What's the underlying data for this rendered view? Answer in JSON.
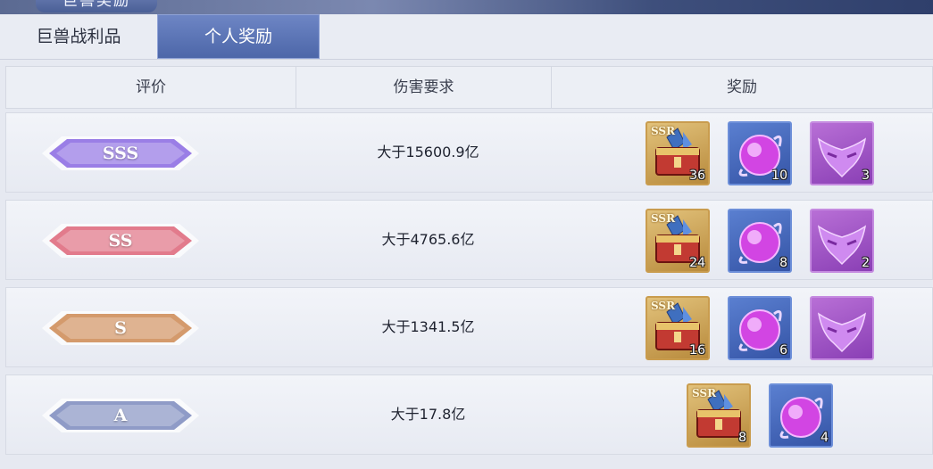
{
  "window": {
    "title": "巨兽奖励"
  },
  "tabs": [
    {
      "label": "巨兽战利品",
      "active": false
    },
    {
      "label": "个人奖励",
      "active": true
    }
  ],
  "table": {
    "headers": [
      "评价",
      "伤害要求",
      "奖励"
    ],
    "rows": [
      {
        "grade": "SSS",
        "grade_color": "#9a7ee6",
        "requirement": "大于15600.9亿",
        "rewards": [
          {
            "icon": "ssr-chest-icon",
            "tag": "SSR",
            "count": "36"
          },
          {
            "icon": "purple-orb-icon",
            "count": "10"
          },
          {
            "icon": "purple-mask-icon",
            "count": "3"
          }
        ]
      },
      {
        "grade": "SS",
        "grade_color": "#e27b8c",
        "requirement": "大于4765.6亿",
        "rewards": [
          {
            "icon": "ssr-chest-icon",
            "tag": "SSR",
            "count": "24"
          },
          {
            "icon": "purple-orb-icon",
            "count": "8"
          },
          {
            "icon": "purple-mask-icon",
            "count": "2"
          }
        ]
      },
      {
        "grade": "S",
        "grade_color": "#d49a6c",
        "requirement": "大于1341.5亿",
        "rewards": [
          {
            "icon": "ssr-chest-icon",
            "tag": "SSR",
            "count": "16"
          },
          {
            "icon": "purple-orb-icon",
            "count": "6"
          },
          {
            "icon": "purple-mask-icon",
            "count": ""
          }
        ]
      },
      {
        "grade": "A",
        "grade_color": "#8f9bc7",
        "requirement": "大于17.8亿",
        "rewards": [
          {
            "icon": "ssr-chest-icon",
            "tag": "SSR",
            "count": "8"
          },
          {
            "icon": "purple-orb-icon",
            "count": "4"
          }
        ]
      }
    ]
  }
}
